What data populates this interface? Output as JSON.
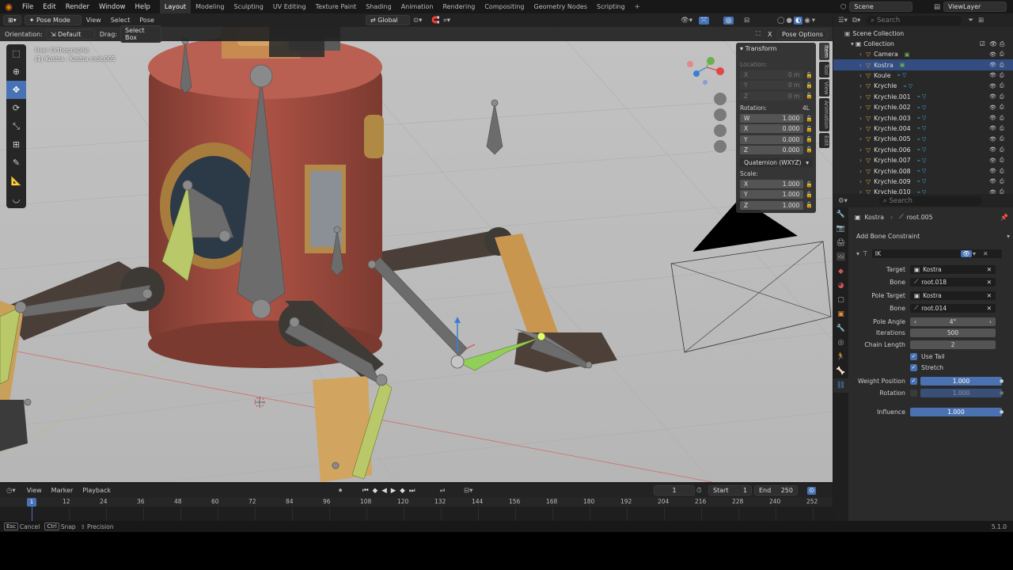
{
  "topbar": {
    "menus": [
      "File",
      "Edit",
      "Render",
      "Window",
      "Help"
    ],
    "workspaces": [
      "Layout",
      "Modeling",
      "Sculpting",
      "UV Editing",
      "Texture Paint",
      "Shading",
      "Animation",
      "Rendering",
      "Compositing",
      "Geometry Nodes",
      "Scripting"
    ],
    "active_workspace": "Layout",
    "add_tab": "+",
    "scene_label": "Scene",
    "viewlayer_label": "ViewLayer"
  },
  "viewport_header": {
    "mode": "Pose Mode",
    "menus": [
      "View",
      "Select",
      "Pose"
    ],
    "transform_orientation": "Global",
    "pose_options": "Pose Options",
    "x_label": "X"
  },
  "tool_settings": {
    "orientation_label": "Orientation:",
    "orientation_value": "Default",
    "drag_label": "Drag:",
    "drag_value": "Select Box"
  },
  "viewport": {
    "view_name": "User Orthographic",
    "object_info": "(1) Kostra : Kostra root.005",
    "gizmo_axes": [
      "X",
      "Y",
      "Z"
    ]
  },
  "npanel": {
    "title": "Transform",
    "location_label": "Location:",
    "location": [
      {
        "axis": "X",
        "value": "0 m"
      },
      {
        "axis": "Y",
        "value": "0 m"
      },
      {
        "axis": "Z",
        "value": "0 m"
      }
    ],
    "rotation_label": "Rotation:",
    "rotation_lock": "4L",
    "rotation": [
      {
        "axis": "W",
        "value": "1.000"
      },
      {
        "axis": "X",
        "value": "0.000"
      },
      {
        "axis": "Y",
        "value": "0.000"
      },
      {
        "axis": "Z",
        "value": "0.000"
      }
    ],
    "rotation_mode": "Quaternion (WXYZ)",
    "scale_label": "Scale:",
    "scale": [
      {
        "axis": "X",
        "value": "1.000"
      },
      {
        "axis": "Y",
        "value": "1.000"
      },
      {
        "axis": "Z",
        "value": "1.000"
      }
    ],
    "tabs": [
      "Item",
      "Tool",
      "View",
      "Animation",
      "Edit"
    ]
  },
  "outliner": {
    "search_placeholder": "Search",
    "root": "Scene Collection",
    "collection": "Collection",
    "items": [
      {
        "name": "Camera",
        "selected": false
      },
      {
        "name": "Kostra",
        "selected": true
      },
      {
        "name": "Koule",
        "selected": false
      },
      {
        "name": "Krychle",
        "selected": false
      },
      {
        "name": "Krychle.001",
        "selected": false
      },
      {
        "name": "Krychle.002",
        "selected": false
      },
      {
        "name": "Krychle.003",
        "selected": false
      },
      {
        "name": "Krychle.004",
        "selected": false
      },
      {
        "name": "Krychle.005",
        "selected": false
      },
      {
        "name": "Krychle.006",
        "selected": false
      },
      {
        "name": "Krychle.007",
        "selected": false
      },
      {
        "name": "Krychle.008",
        "selected": false
      },
      {
        "name": "Krychle.009",
        "selected": false
      },
      {
        "name": "Krychle.010",
        "selected": false
      }
    ]
  },
  "properties": {
    "search_placeholder": "Search",
    "breadcrumb_object": "Kostra",
    "breadcrumb_bone": "root.005",
    "add_constraint": "Add Bone Constraint",
    "constraint_name": "IK",
    "fields": {
      "target_label": "Target",
      "target": "Kostra",
      "bone_label": "Bone",
      "bone": "root.018",
      "pole_target_label": "Pole Target",
      "pole_target": "Kostra",
      "pole_bone_label": "Bone",
      "pole_bone": "root.014",
      "pole_angle_label": "Pole Angle",
      "pole_angle": "4°",
      "iterations_label": "Iterations",
      "iterations": "500",
      "chain_length_label": "Chain Length",
      "chain_length": "2",
      "use_tail_label": "Use Tail",
      "stretch_label": "Stretch",
      "weight_position_label": "Weight Position",
      "weight_position": "1.000",
      "rotation_label": "Rotation",
      "rotation": "1.000",
      "influence_label": "Influence",
      "influence": "1.000"
    }
  },
  "timeline": {
    "menus": [
      "View",
      "Marker",
      "Playback"
    ],
    "current_frame": "1",
    "start_label": "Start",
    "start": "1",
    "end_label": "End",
    "end": "250",
    "ticks": [
      "1",
      "12",
      "24",
      "36",
      "48",
      "60",
      "72",
      "84",
      "96",
      "108",
      "120",
      "132",
      "144",
      "156",
      "168",
      "180",
      "192",
      "204",
      "216",
      "228",
      "240",
      "252"
    ]
  },
  "status": {
    "cancel_key": "Esc",
    "cancel": "Cancel",
    "snap_key": "Ctrl",
    "snap": "Snap",
    "precision": "Precision",
    "version": "5.1.0"
  },
  "colors": {
    "accent": "#4772b3",
    "selected_row": "#334d80",
    "boiler": "#a54a3e",
    "bone_gray": "#6e6e6e",
    "bone_selected": "#b9c96a"
  }
}
